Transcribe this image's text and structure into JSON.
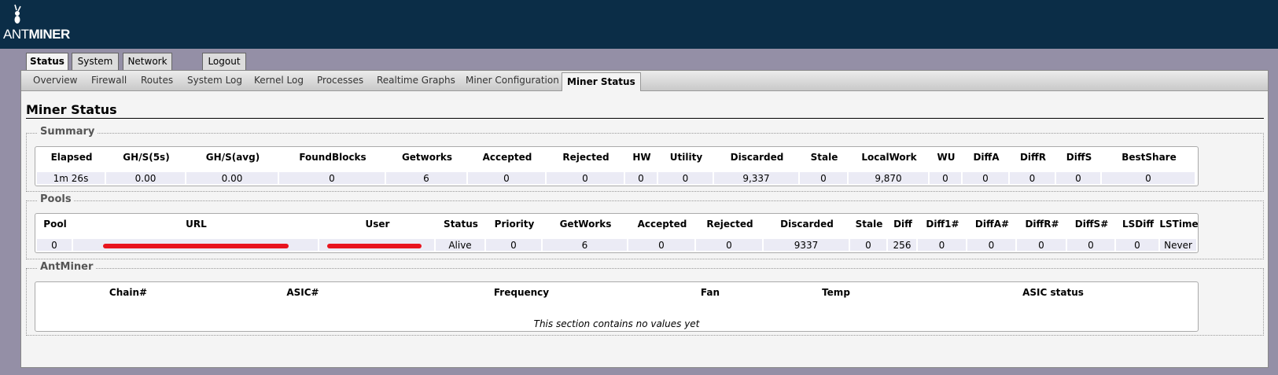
{
  "brand": {
    "ant": "ANT",
    "miner": "MINER"
  },
  "top_tabs": [
    {
      "label": "Status",
      "active": true
    },
    {
      "label": "System",
      "active": false
    },
    {
      "label": "Network",
      "active": false
    },
    {
      "label": "Logout",
      "active": false
    }
  ],
  "sub_tabs": [
    {
      "label": "Overview"
    },
    {
      "label": "Firewall"
    },
    {
      "label": "Routes"
    },
    {
      "label": "System Log"
    },
    {
      "label": "Kernel Log"
    },
    {
      "label": "Processes"
    },
    {
      "label": "Realtime Graphs"
    },
    {
      "label": "Miner Configuration"
    },
    {
      "label": "Miner Status",
      "active": true
    }
  ],
  "page_title": "Miner Status",
  "summary": {
    "legend": "Summary",
    "headers": [
      "Elapsed",
      "GH/S(5s)",
      "GH/S(avg)",
      "FoundBlocks",
      "Getworks",
      "Accepted",
      "Rejected",
      "HW",
      "Utility",
      "Discarded",
      "Stale",
      "LocalWork",
      "WU",
      "DiffA",
      "DiffR",
      "DiffS",
      "BestShare"
    ],
    "values": [
      "1m 26s",
      "0.00",
      "0.00",
      "0",
      "6",
      "0",
      "0",
      "0",
      "0",
      "9,337",
      "0",
      "9,870",
      "0",
      "0",
      "0",
      "0",
      "0"
    ]
  },
  "pools": {
    "legend": "Pools",
    "headers": [
      "Pool",
      "URL",
      "User",
      "Status",
      "Priority",
      "GetWorks",
      "Accepted",
      "Rejected",
      "Discarded",
      "Stale",
      "Diff",
      "Diff1#",
      "DiffA#",
      "DiffR#",
      "DiffS#",
      "LSDiff",
      "LSTime"
    ],
    "values": [
      "0",
      "",
      "",
      "Alive",
      "0",
      "6",
      "0",
      "0",
      "9337",
      "0",
      "256",
      "0",
      "0",
      "0",
      "0",
      "0",
      "Never"
    ]
  },
  "antminer": {
    "legend": "AntMiner",
    "headers": [
      "Chain#",
      "ASIC#",
      "Frequency",
      "Fan",
      "Temp",
      "ASIC status"
    ],
    "empty_message": "This section contains no values yet"
  },
  "colors": {
    "header_bg": "#0b2d47",
    "page_bg": "#948fa6",
    "cell_bg": "#ebebf5",
    "redaction": "#e8141e"
  }
}
